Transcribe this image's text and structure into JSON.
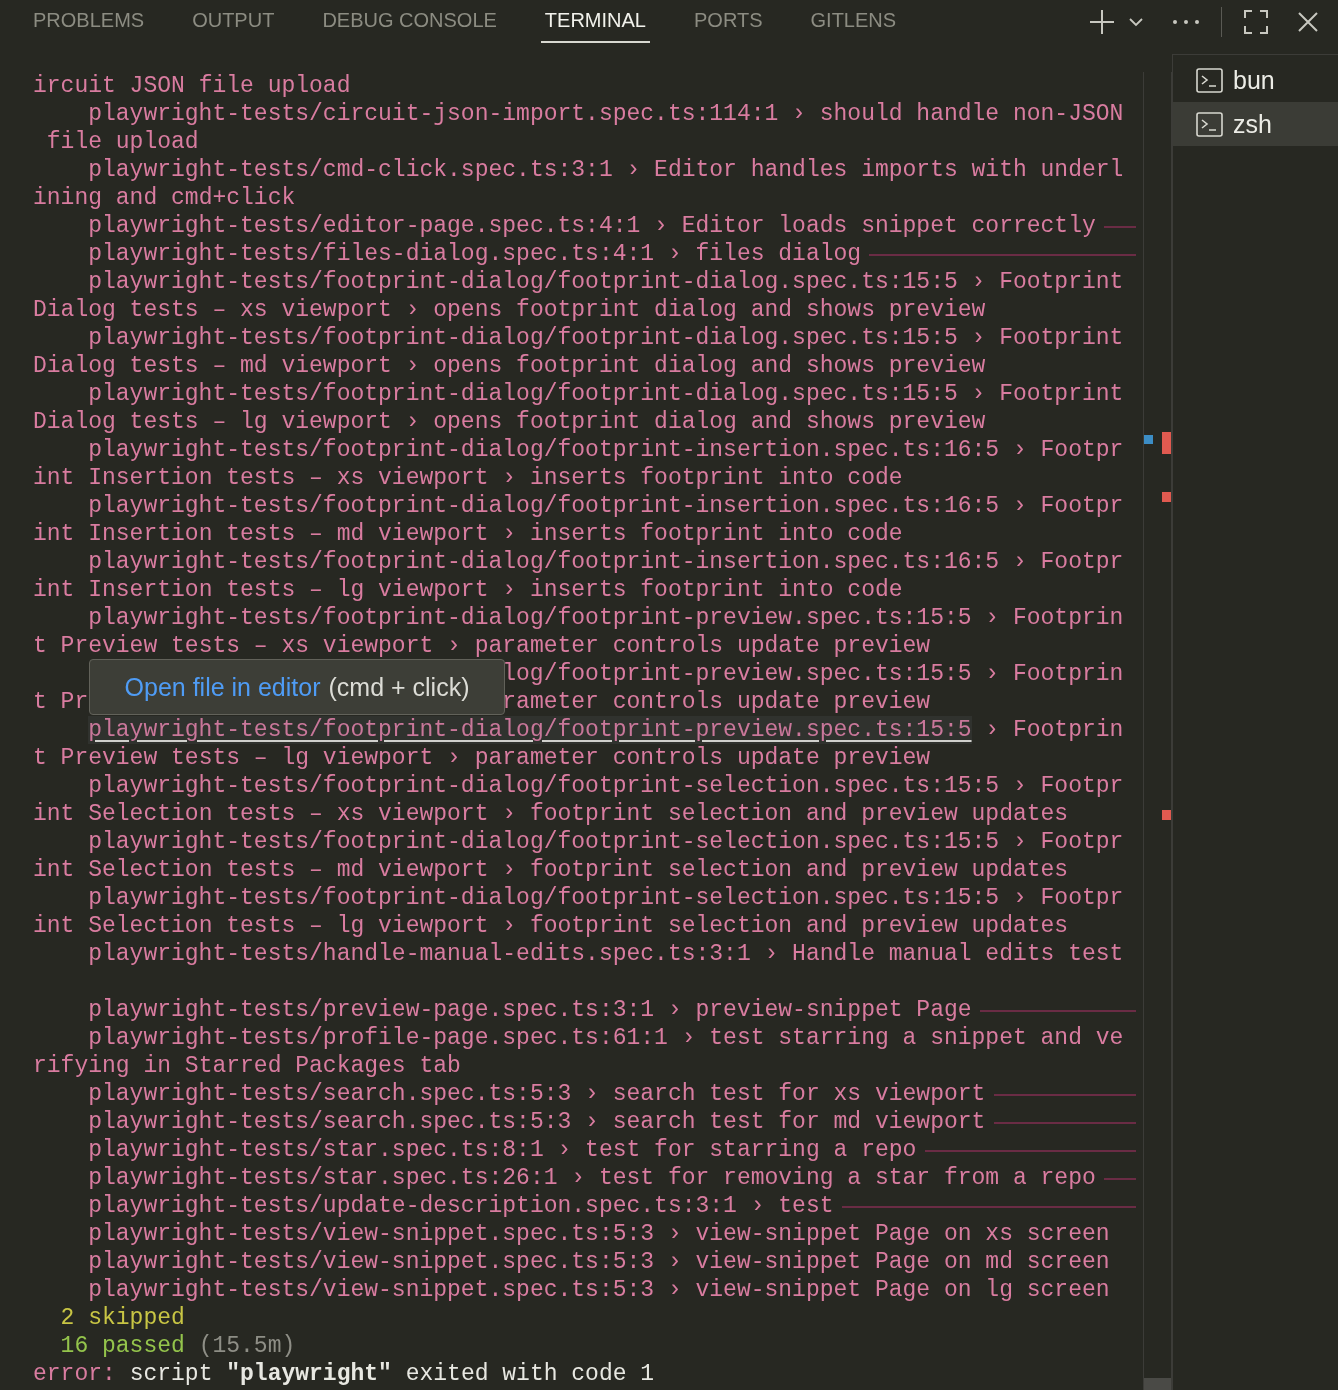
{
  "panel_tabs": [
    {
      "label": "PROBLEMS",
      "selected": false
    },
    {
      "label": "OUTPUT",
      "selected": false
    },
    {
      "label": "DEBUG CONSOLE",
      "selected": false
    },
    {
      "label": "TERMINAL",
      "selected": true
    },
    {
      "label": "PORTS",
      "selected": false
    },
    {
      "label": "GITLENS",
      "selected": false
    }
  ],
  "terminal": {
    "rows": [
      {
        "kind": "wrap",
        "segments": [
          {
            "text": "ircuit JSON file upload",
            "color": "#d97ca0"
          }
        ]
      },
      {
        "kind": "test",
        "segments": [
          {
            "text": "playwright-tests/circuit-json-import.spec.ts:114:1 › should handle non-JSON",
            "color": "#d97ca0"
          }
        ]
      },
      {
        "kind": "wrap",
        "segments": [
          {
            "text": " file upload",
            "color": "#d97ca0"
          }
        ]
      },
      {
        "kind": "test",
        "segments": [
          {
            "text": "playwright-tests/cmd-click.spec.ts:3:1 › Editor handles imports with underl",
            "color": "#d97ca0"
          }
        ]
      },
      {
        "kind": "wrap",
        "segments": [
          {
            "text": "ining and cmd+click",
            "color": "#d97ca0"
          }
        ]
      },
      {
        "kind": "test",
        "trailing_rule": true,
        "segments": [
          {
            "text": "playwright-tests/editor-page.spec.ts:4:1 › Editor loads snippet correctly",
            "color": "#d97ca0"
          }
        ]
      },
      {
        "kind": "test",
        "trailing_rule": true,
        "segments": [
          {
            "text": "playwright-tests/files-dialog.spec.ts:4:1 › files dialog",
            "color": "#d97ca0"
          }
        ]
      },
      {
        "kind": "test",
        "segments": [
          {
            "text": "playwright-tests/footprint-dialog/footprint-dialog.spec.ts:15:5 › Footprint",
            "color": "#d97ca0"
          }
        ]
      },
      {
        "kind": "wrap",
        "segments": [
          {
            "text": "Dialog tests – xs viewport › opens footprint dialog and shows preview",
            "color": "#d97ca0"
          }
        ]
      },
      {
        "kind": "test",
        "segments": [
          {
            "text": "playwright-tests/footprint-dialog/footprint-dialog.spec.ts:15:5 › Footprint",
            "color": "#d97ca0"
          }
        ]
      },
      {
        "kind": "wrap",
        "segments": [
          {
            "text": "Dialog tests – md viewport › opens footprint dialog and shows preview",
            "color": "#d97ca0"
          }
        ]
      },
      {
        "kind": "test",
        "segments": [
          {
            "text": "playwright-tests/footprint-dialog/footprint-dialog.spec.ts:15:5 › Footprint",
            "color": "#d97ca0"
          }
        ]
      },
      {
        "kind": "wrap",
        "segments": [
          {
            "text": "Dialog tests – lg viewport › opens footprint dialog and shows preview",
            "color": "#d97ca0"
          }
        ]
      },
      {
        "kind": "test",
        "segments": [
          {
            "text": "playwright-tests/footprint-dialog/footprint-insertion.spec.ts:16:5 › Footpr",
            "color": "#d97ca0"
          }
        ]
      },
      {
        "kind": "wrap",
        "segments": [
          {
            "text": "int Insertion tests – xs viewport › inserts footprint into code",
            "color": "#d97ca0"
          }
        ]
      },
      {
        "kind": "test",
        "segments": [
          {
            "text": "playwright-tests/footprint-dialog/footprint-insertion.spec.ts:16:5 › Footpr",
            "color": "#d97ca0"
          }
        ]
      },
      {
        "kind": "wrap",
        "segments": [
          {
            "text": "int Insertion tests – md viewport › inserts footprint into code",
            "color": "#d97ca0"
          }
        ]
      },
      {
        "kind": "test",
        "segments": [
          {
            "text": "playwright-tests/footprint-dialog/footprint-insertion.spec.ts:16:5 › Footpr",
            "color": "#d97ca0"
          }
        ]
      },
      {
        "kind": "wrap",
        "segments": [
          {
            "text": "int Insertion tests – lg viewport › inserts footprint into code",
            "color": "#d97ca0"
          }
        ]
      },
      {
        "kind": "test",
        "segments": [
          {
            "text": "playwright-tests/footprint-dialog/footprint-preview.spec.ts:15:5 › Footprin",
            "color": "#d97ca0"
          }
        ]
      },
      {
        "kind": "wrap",
        "segments": [
          {
            "text": "t Preview tests – xs viewport › parameter controls update preview",
            "color": "#d97ca0"
          }
        ]
      },
      {
        "kind": "wrap",
        "segments": [
          {
            "text": "log/footprint-preview.spec.ts:15:5 › Footprin",
            "color": "#d97ca0",
            "after_tooltip": true
          }
        ]
      },
      {
        "kind": "wrap",
        "segments": [
          {
            "text": "t Pr",
            "color": "#d97ca0"
          },
          {
            "text": "rameter controls update preview",
            "color": "#d97ca0",
            "after_tooltip": true
          }
        ]
      },
      {
        "kind": "test",
        "segments": [
          {
            "text": "playwright-tests/footprint-dialog/footprint-preview.spec.ts:15:5",
            "color": "#c9779a",
            "link": true,
            "hovered": true
          },
          {
            "text": " › Footprin",
            "color": "#d97ca0"
          }
        ]
      },
      {
        "kind": "wrap",
        "segments": [
          {
            "text": "t Preview tests – lg viewport › parameter controls update preview",
            "color": "#d97ca0"
          }
        ]
      },
      {
        "kind": "test",
        "segments": [
          {
            "text": "playwright-tests/footprint-dialog/footprint-selection.spec.ts:15:5 › Footpr",
            "color": "#d97ca0"
          }
        ]
      },
      {
        "kind": "wrap",
        "segments": [
          {
            "text": "int Selection tests – xs viewport › footprint selection and preview updates",
            "color": "#d97ca0"
          }
        ]
      },
      {
        "kind": "test",
        "segments": [
          {
            "text": "playwright-tests/footprint-dialog/footprint-selection.spec.ts:15:5 › Footpr",
            "color": "#d97ca0"
          }
        ]
      },
      {
        "kind": "wrap",
        "segments": [
          {
            "text": "int Selection tests – md viewport › footprint selection and preview updates",
            "color": "#d97ca0"
          }
        ]
      },
      {
        "kind": "test",
        "segments": [
          {
            "text": "playwright-tests/footprint-dialog/footprint-selection.spec.ts:15:5 › Footpr",
            "color": "#d97ca0"
          }
        ]
      },
      {
        "kind": "wrap",
        "segments": [
          {
            "text": "int Selection tests – lg viewport › footprint selection and preview updates",
            "color": "#d97ca0"
          }
        ]
      },
      {
        "kind": "test",
        "segments": [
          {
            "text": "playwright-tests/handle-manual-edits.spec.ts:3:1 › Handle manual edits test",
            "color": "#d97ca0"
          }
        ]
      },
      {
        "kind": "blank"
      },
      {
        "kind": "test",
        "trailing_rule": true,
        "segments": [
          {
            "text": "playwright-tests/preview-page.spec.ts:3:1 › preview-snippet Page",
            "color": "#d97ca0"
          }
        ]
      },
      {
        "kind": "test",
        "segments": [
          {
            "text": "playwright-tests/profile-page.spec.ts:61:1 › test starring a snippet and ve",
            "color": "#d97ca0"
          }
        ]
      },
      {
        "kind": "wrap",
        "segments": [
          {
            "text": "rifying in Starred Packages tab",
            "color": "#d97ca0"
          }
        ]
      },
      {
        "kind": "test",
        "trailing_rule": true,
        "segments": [
          {
            "text": "playwright-tests/search.spec.ts:5:3 › search test for xs viewport",
            "color": "#d97ca0"
          }
        ]
      },
      {
        "kind": "test",
        "trailing_rule": true,
        "segments": [
          {
            "text": "playwright-tests/search.spec.ts:5:3 › search test for md viewport",
            "color": "#d97ca0"
          }
        ]
      },
      {
        "kind": "test",
        "trailing_rule": true,
        "segments": [
          {
            "text": "playwright-tests/star.spec.ts:8:1 › test for starring a repo",
            "color": "#d97ca0"
          }
        ]
      },
      {
        "kind": "test",
        "trailing_rule": true,
        "segments": [
          {
            "text": "playwright-tests/star.spec.ts:26:1 › test for removing a star from a repo",
            "color": "#d97ca0"
          }
        ]
      },
      {
        "kind": "test",
        "trailing_rule": true,
        "segments": [
          {
            "text": "playwright-tests/update-description.spec.ts:3:1 › test",
            "color": "#d97ca0"
          }
        ]
      },
      {
        "kind": "test",
        "segments": [
          {
            "text": "playwright-tests/view-snippet.spec.ts:5:3 › view-snippet Page on xs screen",
            "color": "#d97ca0"
          }
        ]
      },
      {
        "kind": "test",
        "segments": [
          {
            "text": "playwright-tests/view-snippet.spec.ts:5:3 › view-snippet Page on md screen",
            "color": "#d97ca0"
          }
        ]
      },
      {
        "kind": "test",
        "segments": [
          {
            "text": "playwright-tests/view-snippet.spec.ts:5:3 › view-snippet Page on lg screen",
            "color": "#d97ca0"
          }
        ]
      },
      {
        "kind": "summary",
        "segments": [
          {
            "text": "2 skipped",
            "color": "#c8c544"
          }
        ]
      },
      {
        "kind": "summary",
        "segments": [
          {
            "text": "16 passed",
            "color": "#94c44c"
          },
          {
            "text": " (15.5m)",
            "color": "#8e8e86"
          }
        ]
      },
      {
        "kind": "wrap",
        "segments": [
          {
            "text": "error:",
            "color": "#d97ca0"
          },
          {
            "text": " script **\"playwright\"** exited with code 1",
            "color": "#e8e8e2"
          }
        ]
      }
    ],
    "tooltip": {
      "action": "Open file in editor",
      "hint": "(cmd + click)"
    }
  },
  "sessions": [
    {
      "name": "bun",
      "selected": false
    },
    {
      "name": "zsh",
      "selected": true
    }
  ]
}
